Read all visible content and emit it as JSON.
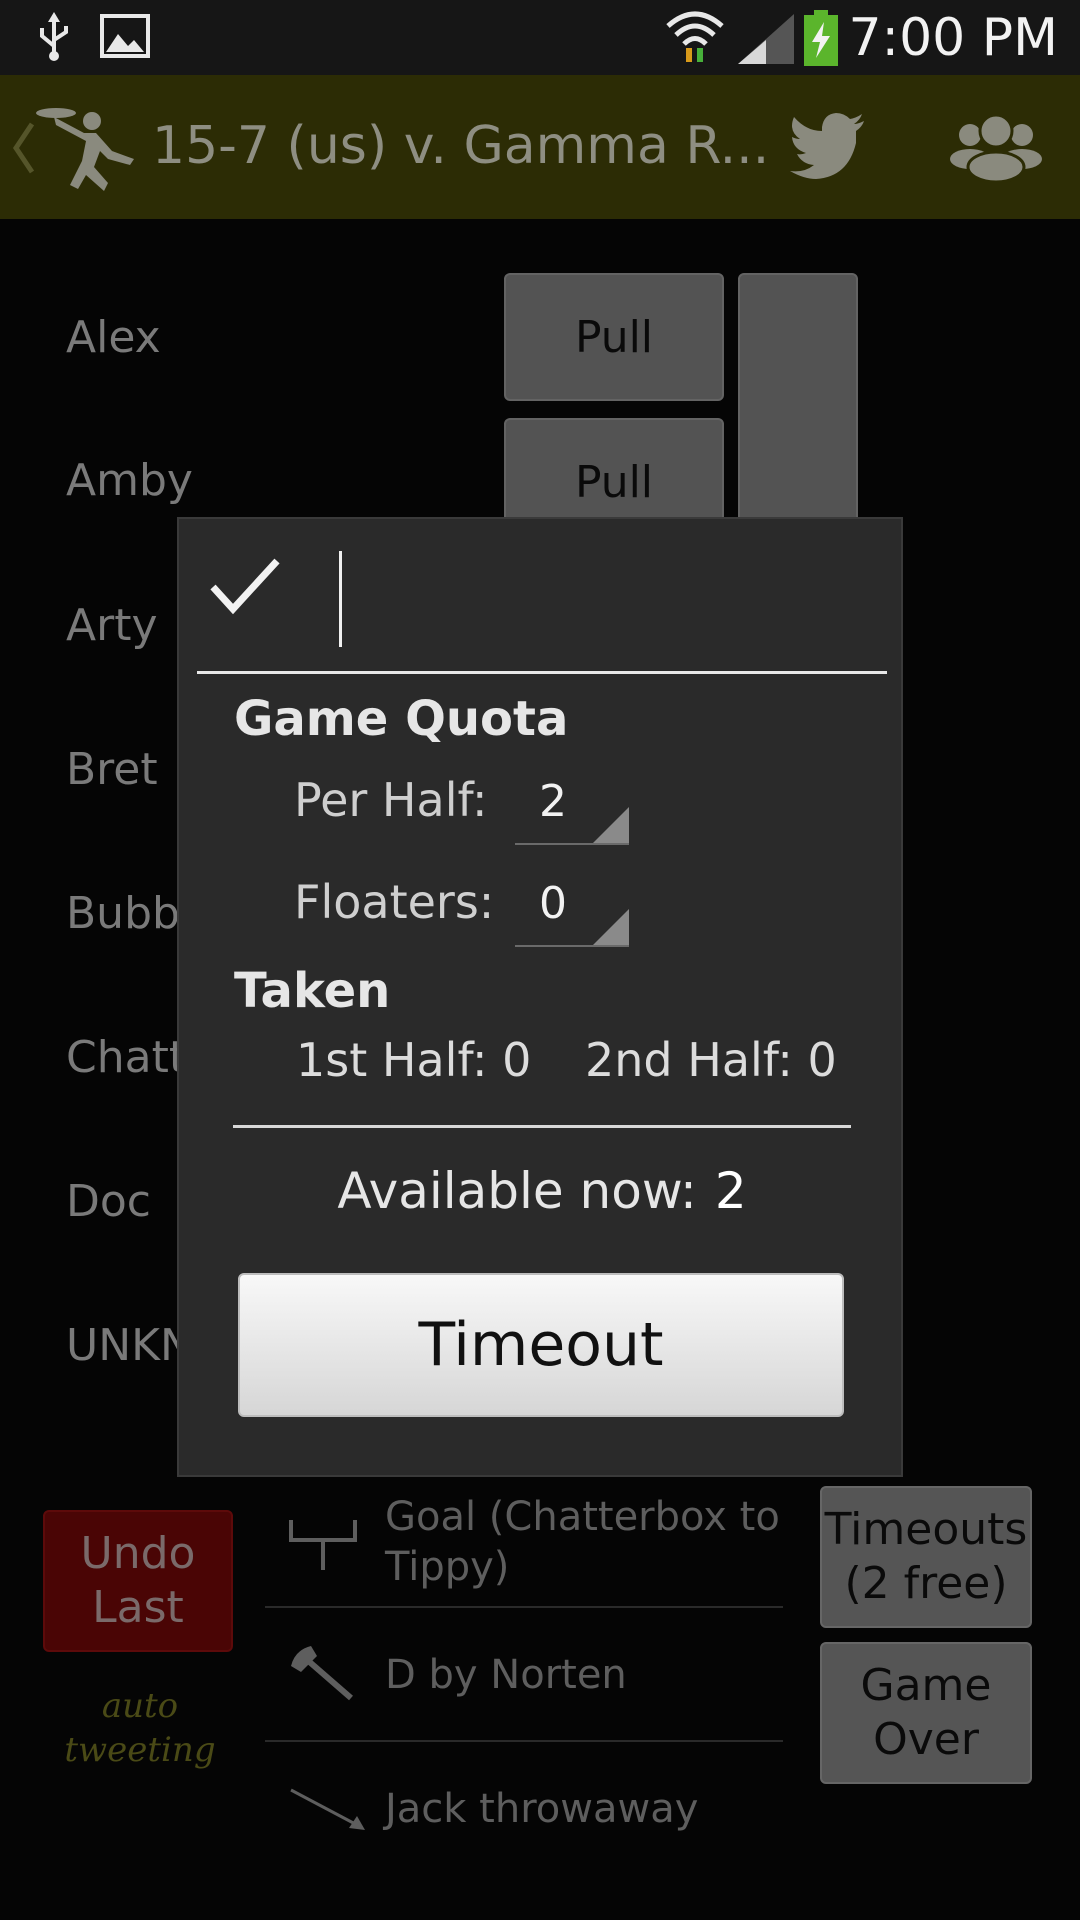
{
  "status_bar": {
    "time": "7:00 PM"
  },
  "action_bar": {
    "title": "15-7 (us) v. Gamma R..."
  },
  "players": [
    {
      "name": "Alex",
      "button": "Pull"
    },
    {
      "name": "Amby",
      "button": "Pull"
    },
    {
      "name": "Arty"
    },
    {
      "name": "Bret"
    },
    {
      "name": "Bubb"
    },
    {
      "name": "Chatt"
    },
    {
      "name": "Doc"
    },
    {
      "name": "UNKN"
    }
  ],
  "undo_button": {
    "line1": "Undo",
    "line2": "Last"
  },
  "auto_tweeting": {
    "line1": "auto",
    "line2": "tweeting"
  },
  "events": [
    {
      "icon": "goal-post-icon",
      "line1": "Goal (Chatterbox to",
      "line2": "Tippy)"
    },
    {
      "icon": "axe-icon",
      "line1": "D by Norten"
    },
    {
      "icon": "arrow-icon",
      "line1": "Jack throwaway"
    }
  ],
  "timeouts_button": {
    "line1": "Timeouts",
    "line2": "(2 free)"
  },
  "game_over_button": {
    "line1": "Game",
    "line2": "Over"
  },
  "dialog": {
    "input_value": "",
    "game_quota_heading": "Game Quota",
    "per_half_label": "Per Half:",
    "per_half_value": "2",
    "floaters_label": "Floaters:",
    "floaters_value": "0",
    "taken_heading": "Taken",
    "first_half_label": "1st Half:",
    "first_half_value": "0",
    "second_half_label": "2nd Half:",
    "second_half_value": "0",
    "available_label": "Available now:",
    "available_value": "2",
    "timeout_button": "Timeout"
  },
  "colors": {
    "action_bar": "#2c2c05",
    "undo": "#4a0505",
    "auto_tweet": "#4a4a16"
  }
}
